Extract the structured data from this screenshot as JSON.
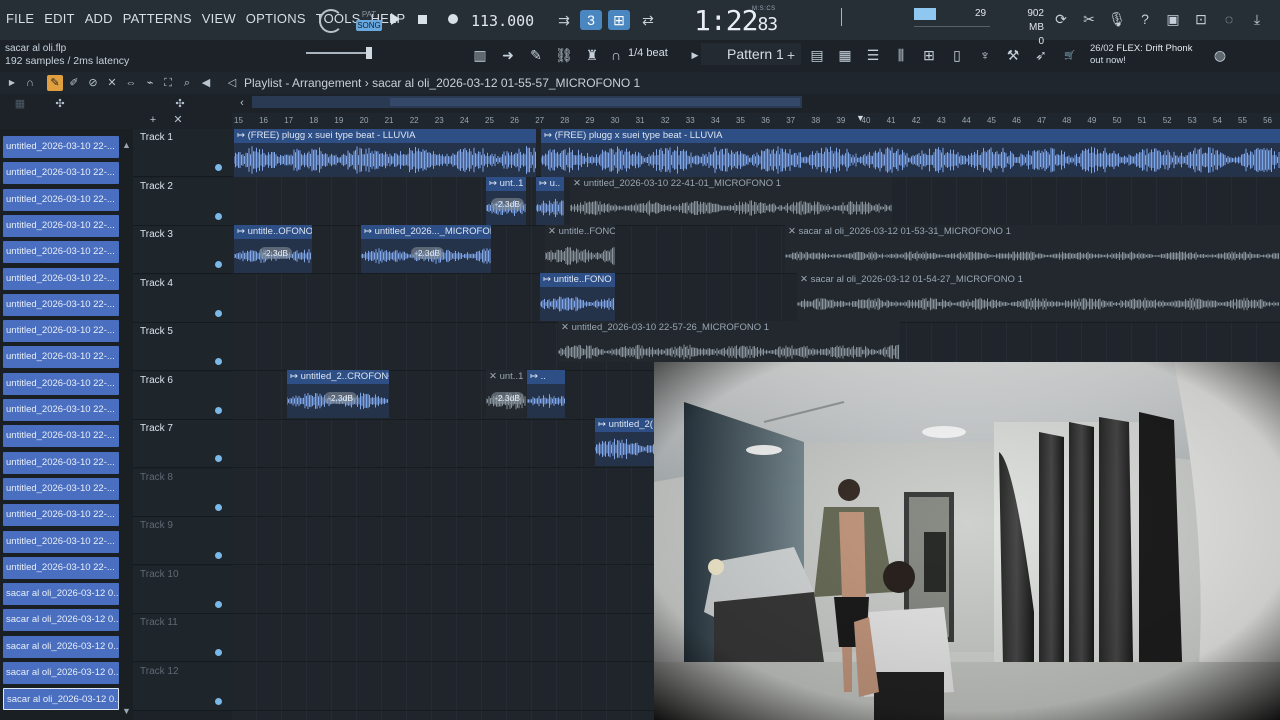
{
  "menu": [
    "FILE",
    "EDIT",
    "ADD",
    "PATTERNS",
    "VIEW",
    "OPTIONS",
    "TOOLS",
    "HELP"
  ],
  "transport": {
    "pat_label": "PAT",
    "song_label": "SONG",
    "tempo": "113.000",
    "time_main": "1:22",
    "time_frac": "83",
    "time_unit": "M:S:CS"
  },
  "cpu": {
    "value": "29"
  },
  "memory": {
    "mb": "902 MB",
    "polyphony": "0"
  },
  "project": {
    "filename": "sacar al oli.flp",
    "latency": "192 samples / 2ms latency"
  },
  "snap_label": "1/4 beat",
  "pattern_label": "Pattern 1",
  "news": {
    "date": "26/02",
    "title": "FLEX: Drift Phonk",
    "subtitle": "out now!"
  },
  "playlist": {
    "title": "Playlist - Arrangement",
    "separator": "›",
    "selected_clip": "sacar al oli_2026-03-12 01-55-57_MICROFONO 1"
  },
  "ruler_bars": [
    "15",
    "16",
    "17",
    "18",
    "19",
    "20",
    "21",
    "22",
    "23",
    "24",
    "25",
    "26",
    "27",
    "28",
    "29",
    "30",
    "31",
    "32",
    "33",
    "34",
    "35",
    "36",
    "37",
    "38",
    "39",
    "40",
    "41",
    "42",
    "43",
    "44",
    "45",
    "46",
    "47",
    "48",
    "49",
    "50",
    "51",
    "52",
    "53",
    "54",
    "55",
    "56"
  ],
  "picker_items": [
    "untitled_2026-03-10 22-...",
    "untitled_2026-03-10 22-...",
    "untitled_2026-03-10 22-...",
    "untitled_2026-03-10 22-...",
    "untitled_2026-03-10 22-...",
    "untitled_2026-03-10 22-...",
    "untitled_2026-03-10 22-...",
    "untitled_2026-03-10 22-...",
    "untitled_2026-03-10 22-...",
    "untitled_2026-03-10 22-...",
    "untitled_2026-03-10 22-...",
    "untitled_2026-03-10 22-...",
    "untitled_2026-03-10 22-...",
    "untitled_2026-03-10 22-...",
    "untitled_2026-03-10 22-...",
    "untitled_2026-03-10 22-...",
    "untitled_2026-03-10 22-...",
    "sacar al oli_2026-03-12 0...",
    "sacar al oli_2026-03-12 0...",
    "sacar al oli_2026-03-12 0...",
    "sacar al oli_2026-03-12 0...",
    "sacar al oli_2026-03-12 0..."
  ],
  "tracks": [
    "Track 1",
    "Track 2",
    "Track 3",
    "Track 4",
    "Track 5",
    "Track 6",
    "Track 7",
    "Track 8",
    "Track 9",
    "Track 10",
    "Track 11",
    "Track 12"
  ],
  "clips": {
    "t1a": "↦ (FREE) plugg x suei type beat - LLUVIA",
    "t1b": "↦ (FREE) plugg x suei type beat - LLUVIA",
    "t2a": "↦ unt..1",
    "t2b": "↦ u..",
    "t2c": "✕ untitled_2026-03-10 22-41-01_MICROFONO 1",
    "t3a": "↦ untitle..OFONO 1",
    "t3b": "↦ untitled_2026..._MICROFONO 1",
    "t3c": "✕ untitle..FONO 1",
    "t3d": "✕ sacar al oli_2026-03-12 01-53-31_MICROFONO 1",
    "t4a": "↦ untitle..FONO 1",
    "t4b": "✕ sacar al oli_2026-03-12 01-54-27_MICROFONO 1",
    "t5a": "✕ untitled_2026-03-10 22-57-26_MICROFONO 1",
    "t6a": "↦ untitled_2..CROFONO 1",
    "t6b": "✕ unt..1",
    "t7a": "↦ untitled_2("
  },
  "db_label": "-2.3dB",
  "colors": {
    "accent": "#4a86c0",
    "clip_blue": "#2e4f86",
    "picker_blue": "#4a6fc0",
    "wave_blue": "#7ea6ea"
  }
}
